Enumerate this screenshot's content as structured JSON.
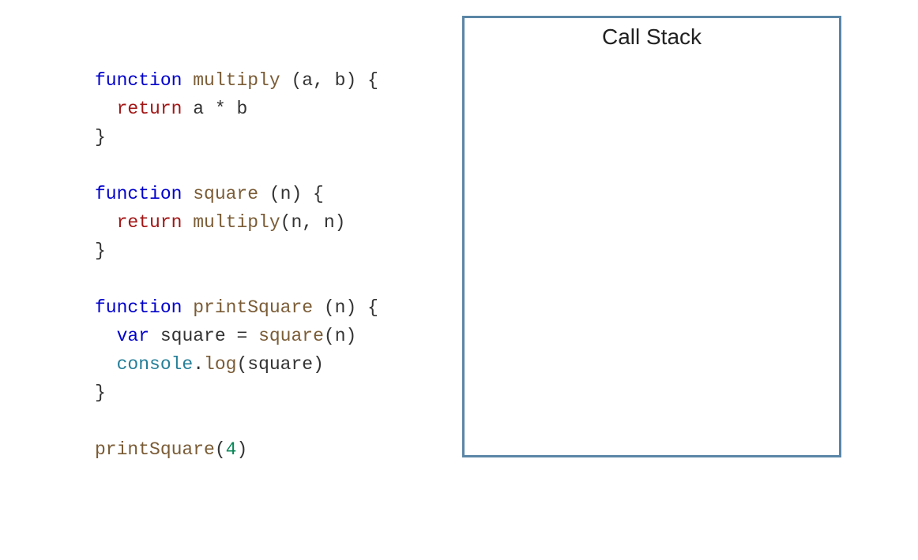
{
  "callstack": {
    "title": "Call Stack"
  },
  "code": {
    "line1_kw": "function",
    "line1_fn": " multiply",
    "line1_rest": " (a, b) {",
    "line2_guide": "  ",
    "line2_ret": "return",
    "line2_rest": " a * b",
    "line3": "}",
    "blank": "",
    "line4_kw": "function",
    "line4_fn": " square",
    "line4_rest": " (n) {",
    "line5_guide": "  ",
    "line5_ret": "return",
    "line5_call": " multiply",
    "line5_rest": "(n, n)",
    "line6": "}",
    "line7_kw": "function",
    "line7_fn": " printSquare",
    "line7_rest": " (n) {",
    "line8_guide": "  ",
    "line8_var": "var",
    "line8_name": " square ",
    "line8_eq": "= ",
    "line8_call": "square",
    "line8_rest": "(n)",
    "line9_guide": "  ",
    "line9_obj": "console",
    "line9_dot": ".",
    "line9_call": "log",
    "line9_rest": "(square)",
    "line10": "}",
    "line11_call": "printSquare",
    "line11_paren": "(",
    "line11_num": "4",
    "line11_close": ")"
  }
}
